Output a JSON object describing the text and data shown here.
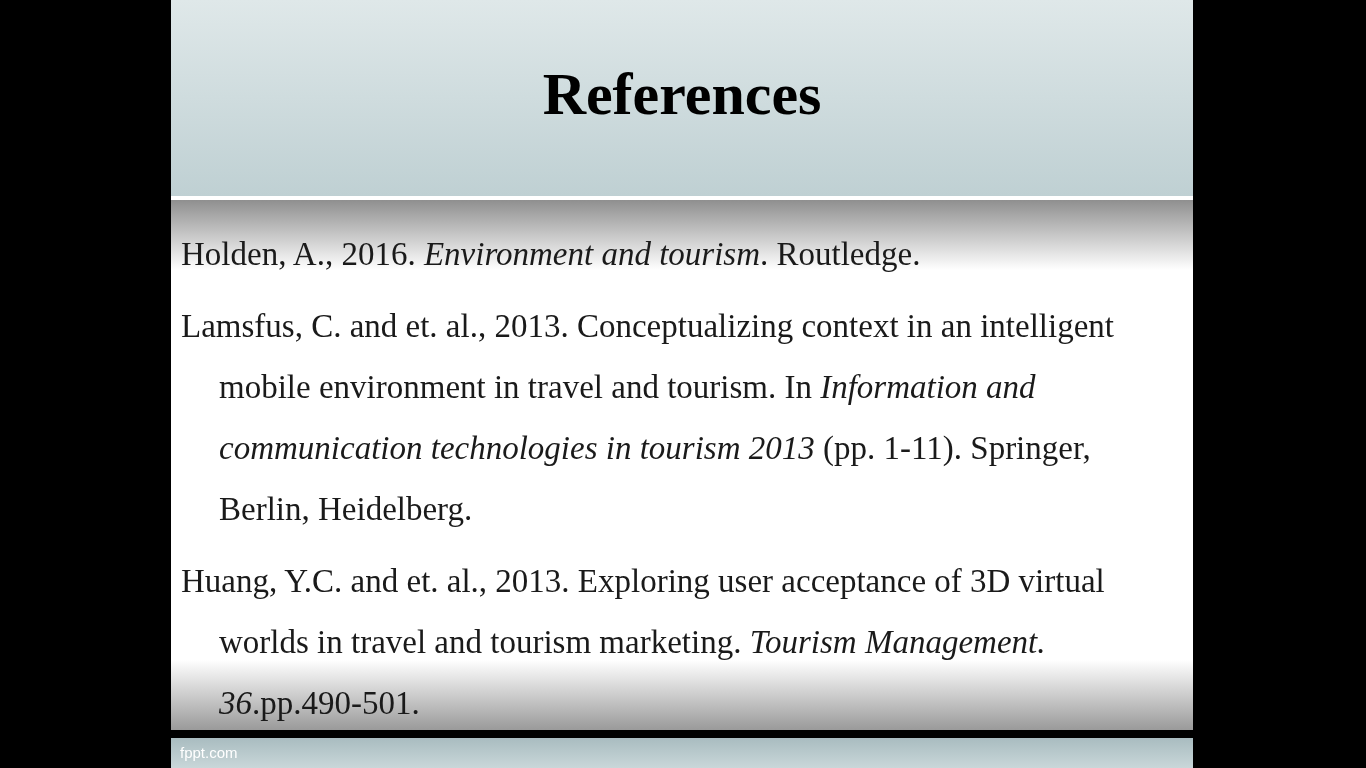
{
  "slide": {
    "title": "References",
    "references": [
      "Holden, A., 2016. *Environment and tourism*. Routledge.",
      "Lamsfus, C. and et. al., 2013. Conceptualizing context in an intelligent mobile environment in travel and tourism. In *Information and communication technologies in tourism 2013* (pp. 1-11). Springer, Berlin, Heidelberg.",
      "Huang, Y.C. and et. al., 2013. Exploring user acceptance of 3D virtual worlds in travel and tourism marketing. *Tourism Management. 36*.pp.490-501."
    ],
    "footer": "fppt.com"
  }
}
